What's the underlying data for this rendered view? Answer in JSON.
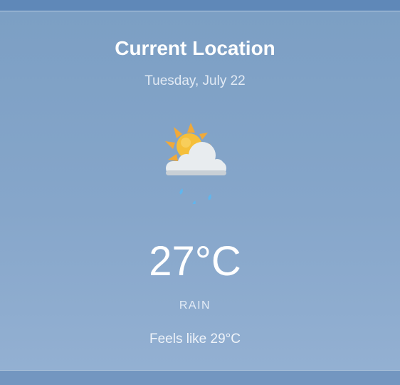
{
  "weather": {
    "location": "Current Location",
    "date": "Tuesday, July 22",
    "temperature": "27°C",
    "condition": "RAIN",
    "feels_like": "Feels like 29°C",
    "icon": "sun-cloud-rain-icon"
  },
  "colors": {
    "sun": "#f5bf3a",
    "sun_rays": "#f0a93a",
    "cloud": "#e8ecef",
    "rain": "#5fb6ee"
  }
}
